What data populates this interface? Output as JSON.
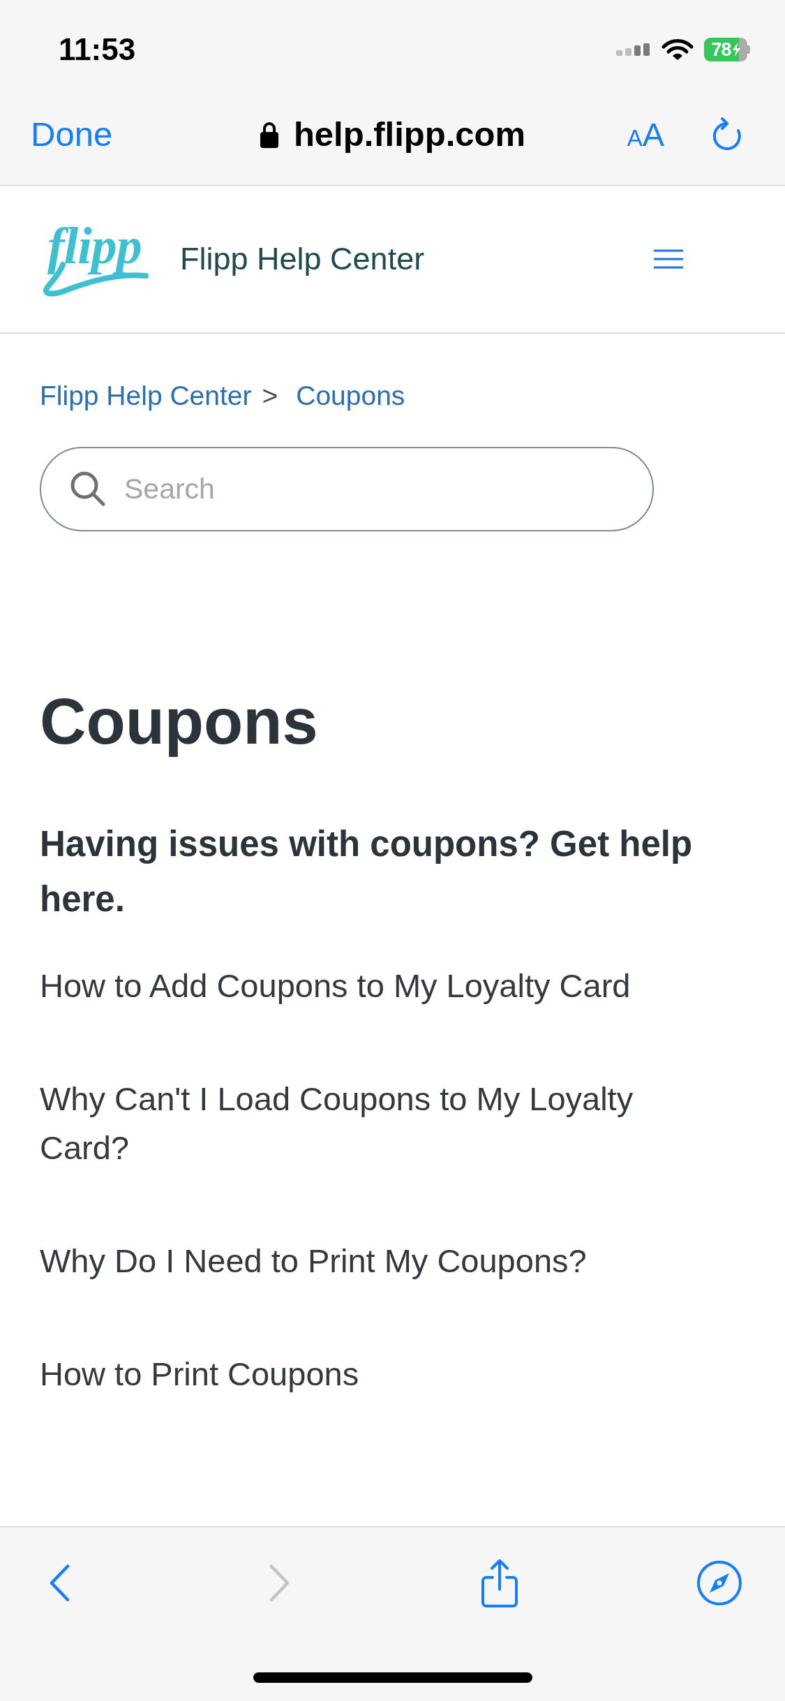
{
  "status_bar": {
    "time": "11:53",
    "battery_percent": "78"
  },
  "browser_bar": {
    "done_label": "Done",
    "url": "help.flipp.com",
    "text_size_label": "AA"
  },
  "site_header": {
    "logo_text": "flipp",
    "title": "Flipp Help Center"
  },
  "breadcrumb": {
    "items": [
      {
        "label": "Flipp Help Center"
      },
      {
        "label": "Coupons"
      }
    ],
    "separator": ">"
  },
  "search": {
    "placeholder": "Search"
  },
  "category": {
    "title": "Coupons",
    "description": "Having issues with coupons? Get help here.",
    "articles": [
      {
        "title": "How to Add Coupons to My Loyalty Card"
      },
      {
        "title": "Why Can't I Load Coupons to My Loyalty Card?"
      },
      {
        "title": "Why Do I Need to Print My Coupons?"
      },
      {
        "title": "How to Print Coupons"
      }
    ]
  },
  "toolbar": {
    "buttons": [
      {
        "kind": "back",
        "disabled": false
      },
      {
        "kind": "forward",
        "disabled": true
      },
      {
        "kind": "share",
        "disabled": false
      },
      {
        "kind": "compass",
        "disabled": false
      }
    ]
  }
}
